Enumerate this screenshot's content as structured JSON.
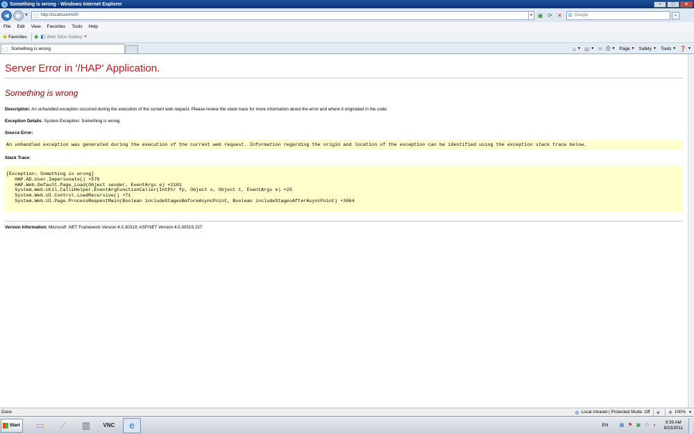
{
  "window": {
    "title": "Something is wrong - Windows Internet Explorer"
  },
  "address_bar": {
    "url": "http://localhost/HAP/"
  },
  "search": {
    "placeholder": "Google"
  },
  "menu": [
    "File",
    "Edit",
    "View",
    "Favorites",
    "Tools",
    "Help"
  ],
  "favorites": {
    "label": "Favorites",
    "web_slice": "Web Slice Gallery"
  },
  "tab": {
    "title": "Something is wrong"
  },
  "command_bar": {
    "page": "Page",
    "safety": "Safety",
    "tools": "Tools"
  },
  "page": {
    "title": "Server Error in '/HAP' Application.",
    "error_title": "Something is wrong",
    "description_label": "Description:",
    "description_text": "An unhandled exception occurred during the execution of the current web request. Please review the stack trace for more information about the error and where it originated in the code.",
    "exception_label": "Exception Details:",
    "exception_text": "System.Exception: Something is wrong",
    "source_label": "Source Error:",
    "source_text": "An unhandled exception was generated during the execution of the current web request. Information regarding the origin and location of the exception can be identified using the exception stack trace below.",
    "stack_label": "Stack Trace:",
    "stack_lines": [
      "[Exception: Something is wrong]",
      "   HAP.AD.User.Impersonate() +570",
      "   HAP.Web.Default.Page_Load(Object sender, EventArgs e) +2101",
      "   System.Web.Util.CalliHelper.EventArgFunctionCaller(IntPtr fp, Object o, Object t, EventArgs e) +25",
      "   System.Web.UI.Control.LoadRecursive() +71",
      "   System.Web.UI.Page.ProcessRequestMain(Boolean includeStagesBeforeAsyncPoint, Boolean includeStagesAfterAsyncPoint) +3064"
    ],
    "version_label": "Version Information:",
    "version_text": "Microsoft .NET Framework Version:4.0.30319; ASP.NET Version:4.0.30319.237"
  },
  "status": {
    "text": "Done",
    "zone": "Local intranet | Protected Mode: Off",
    "zoom": "100%"
  },
  "taskbar": {
    "start": "Start",
    "lang": "EN",
    "time": "9:39 AM",
    "date": "9/23/2011"
  }
}
